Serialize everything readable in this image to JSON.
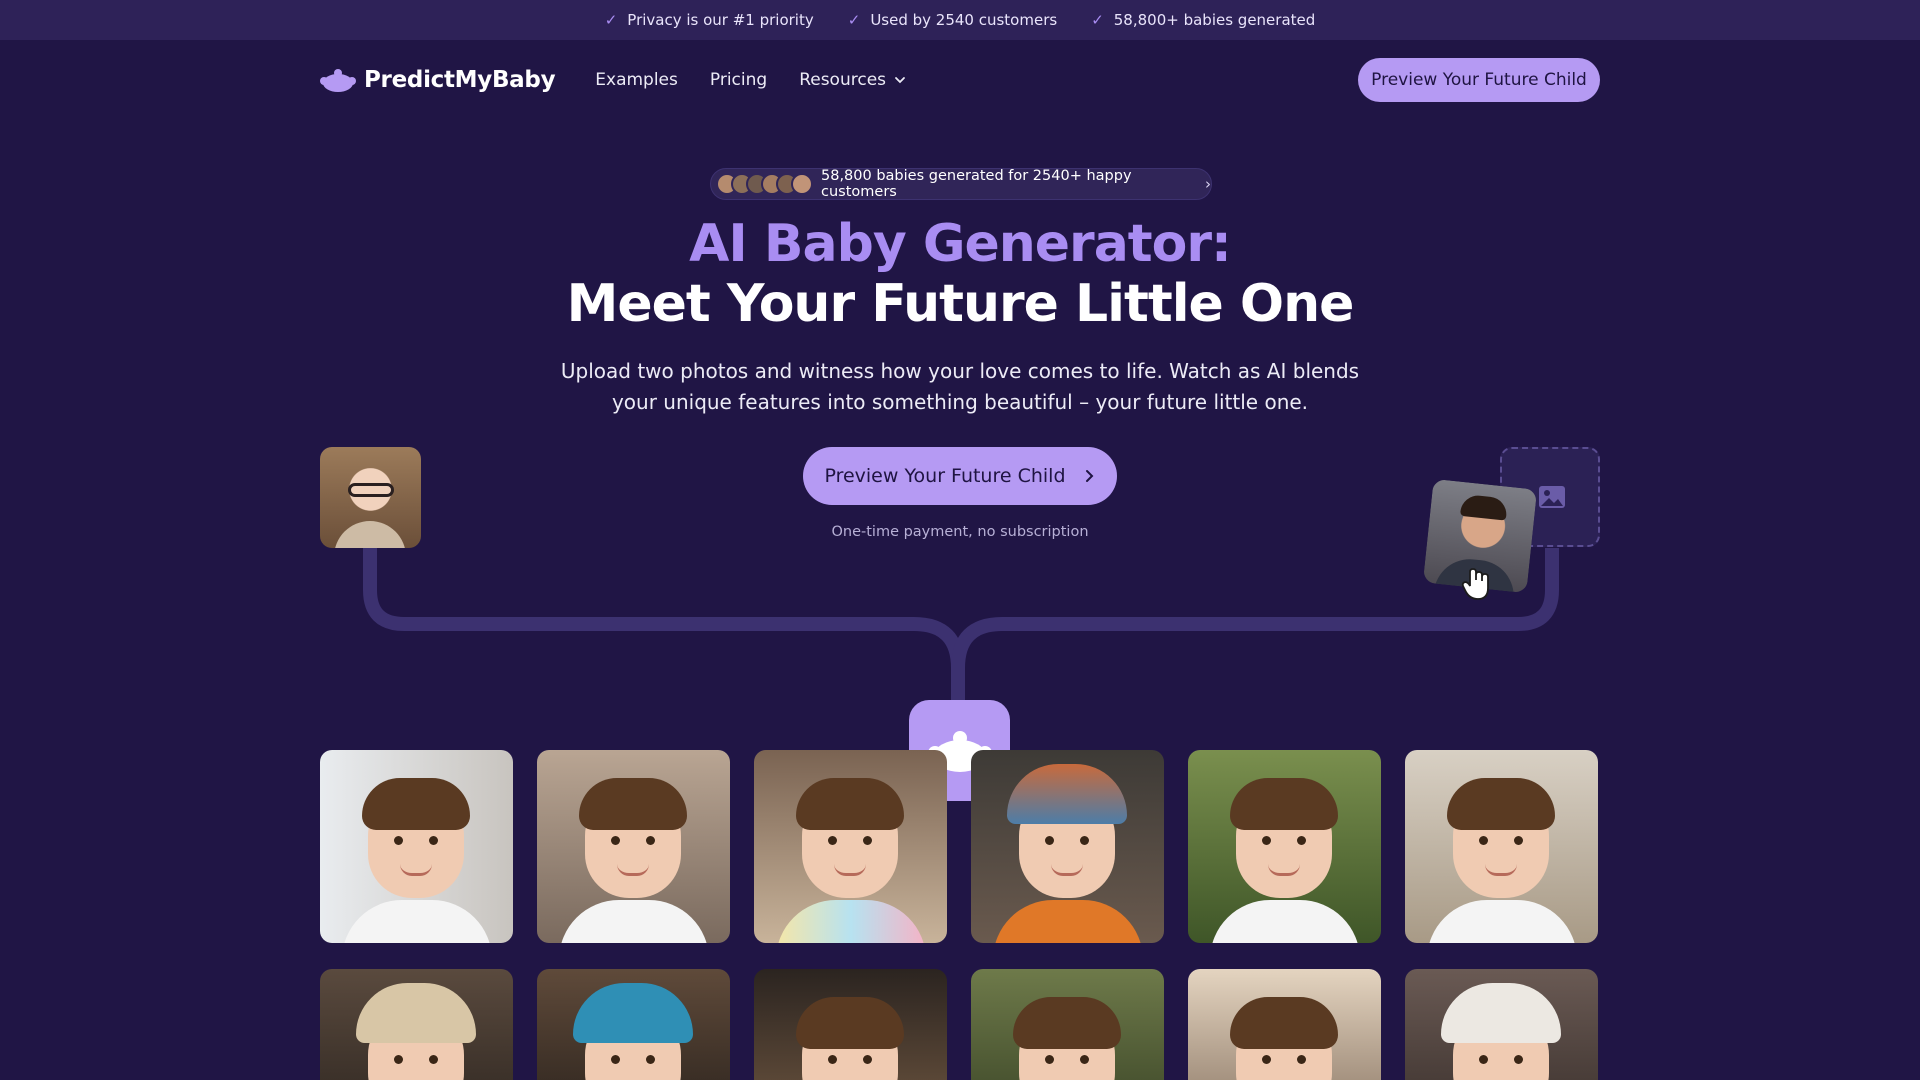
{
  "topbar": {
    "items": [
      {
        "label": "Privacy is our #1 priority"
      },
      {
        "label": "Used by 2540 customers"
      },
      {
        "label": "58,800+ babies generated"
      }
    ]
  },
  "nav": {
    "brand": "PredictMyBaby",
    "links": [
      {
        "label": "Examples"
      },
      {
        "label": "Pricing"
      },
      {
        "label": "Resources"
      }
    ],
    "cta_label": "Preview Your Future Child"
  },
  "hero": {
    "proof_text": "58,800 babies generated for 2540+ happy customers",
    "title_line1": "AI Baby Generator:",
    "title_line2": "Meet Your Future Little One",
    "subtitle": "Upload two photos and witness how your love comes to life. Watch as AI blends your unique features into something beautiful – your future little one.",
    "cta_label": "Preview Your Future Child",
    "note": "One-time payment, no subscription"
  },
  "colors": {
    "background": "#201545",
    "topbar": "#2e2258",
    "accent": "#b59af3",
    "accent_text": "#a98df2"
  },
  "icons": {
    "check": "check-icon",
    "logo": "baby-head-icon",
    "dropdown": "chevron-down-icon",
    "cta_arrow": "chevron-right-icon",
    "placeholder": "image-icon",
    "cursor": "hand-pointer-icon"
  }
}
